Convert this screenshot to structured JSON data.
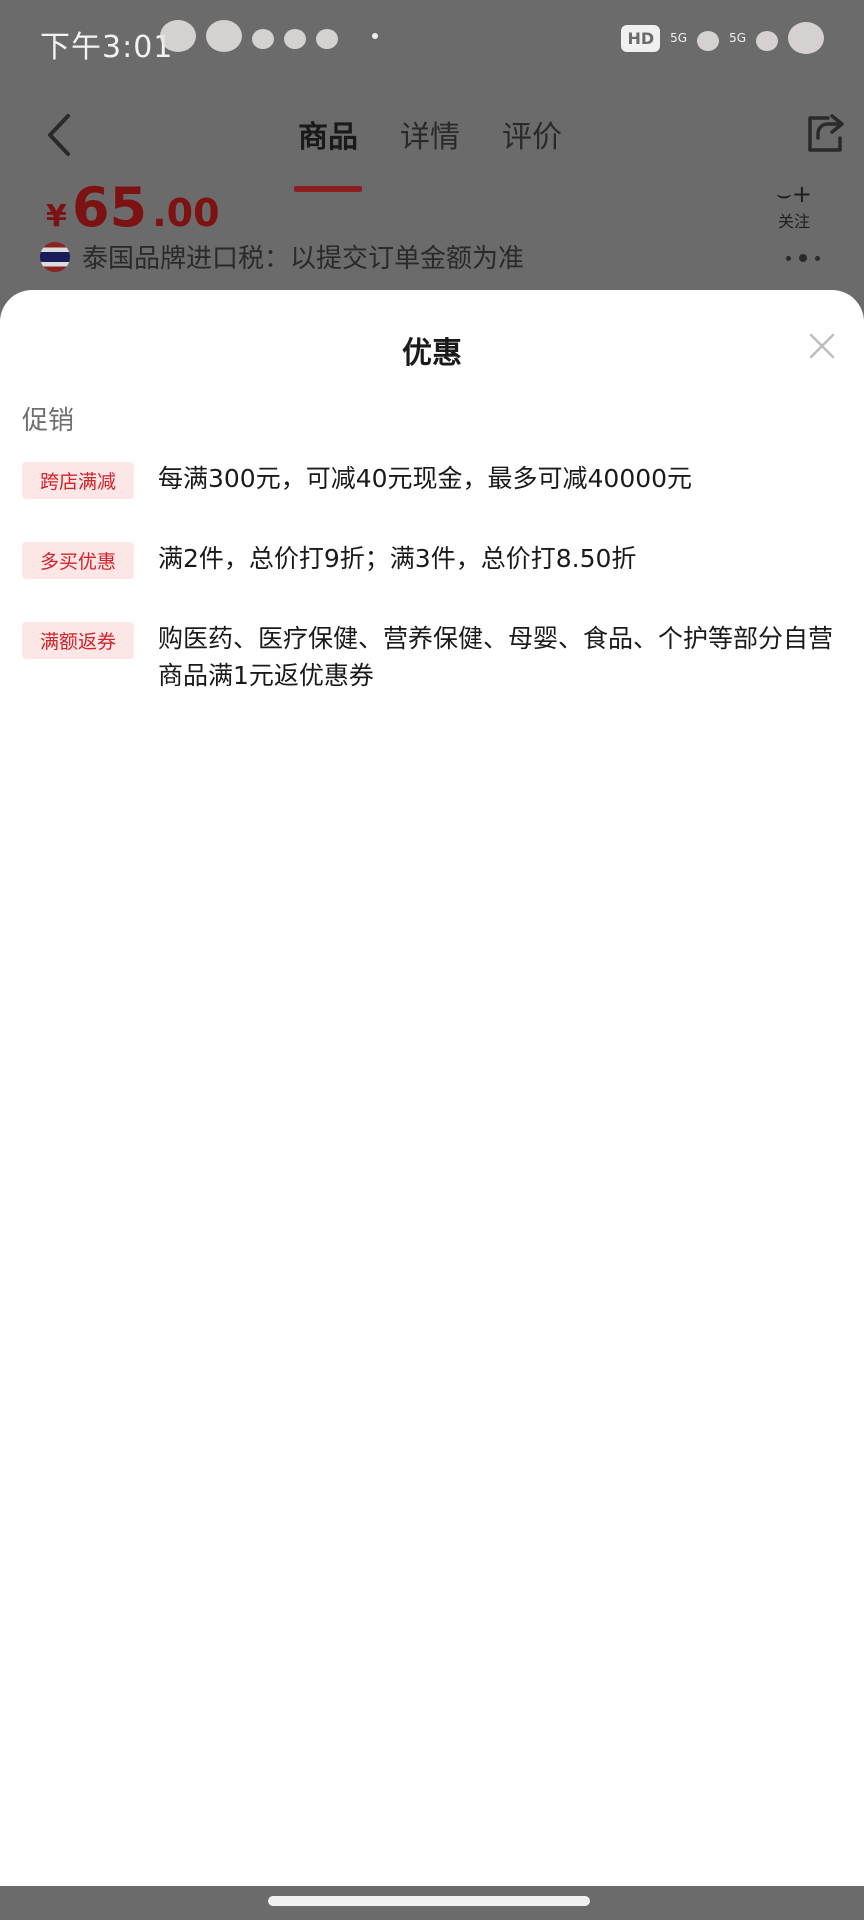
{
  "status_bar": {
    "time": "下午3:01",
    "hd_label": "HD",
    "signal_label": "5G"
  },
  "nav": {
    "tabs": [
      "商品",
      "详情",
      "评价"
    ],
    "active_tab": "商品"
  },
  "product": {
    "price_symbol": "¥",
    "price_integer": "65",
    "price_decimal": ".00",
    "tax_text": "泰国品牌进口税：以提交订单金额为准",
    "follow_label": "关注"
  },
  "sheet": {
    "title": "优惠",
    "section_label": "促销",
    "promotions": [
      {
        "tag": "跨店满减",
        "description": "每满300元，可减40元现金，最多可减40000元"
      },
      {
        "tag": "多买优惠",
        "description": "满2件，总价打9折；满3件，总价打8.50折"
      },
      {
        "tag": "满额返券",
        "description": "购医药、医疗保健、营养保健、母婴、食品、个护等部分自营商品满1元返优惠券"
      }
    ]
  },
  "colors": {
    "accent": "#d2232a",
    "tag_background": "#fde6e6",
    "dim_overlay": "#6b6b6b"
  }
}
